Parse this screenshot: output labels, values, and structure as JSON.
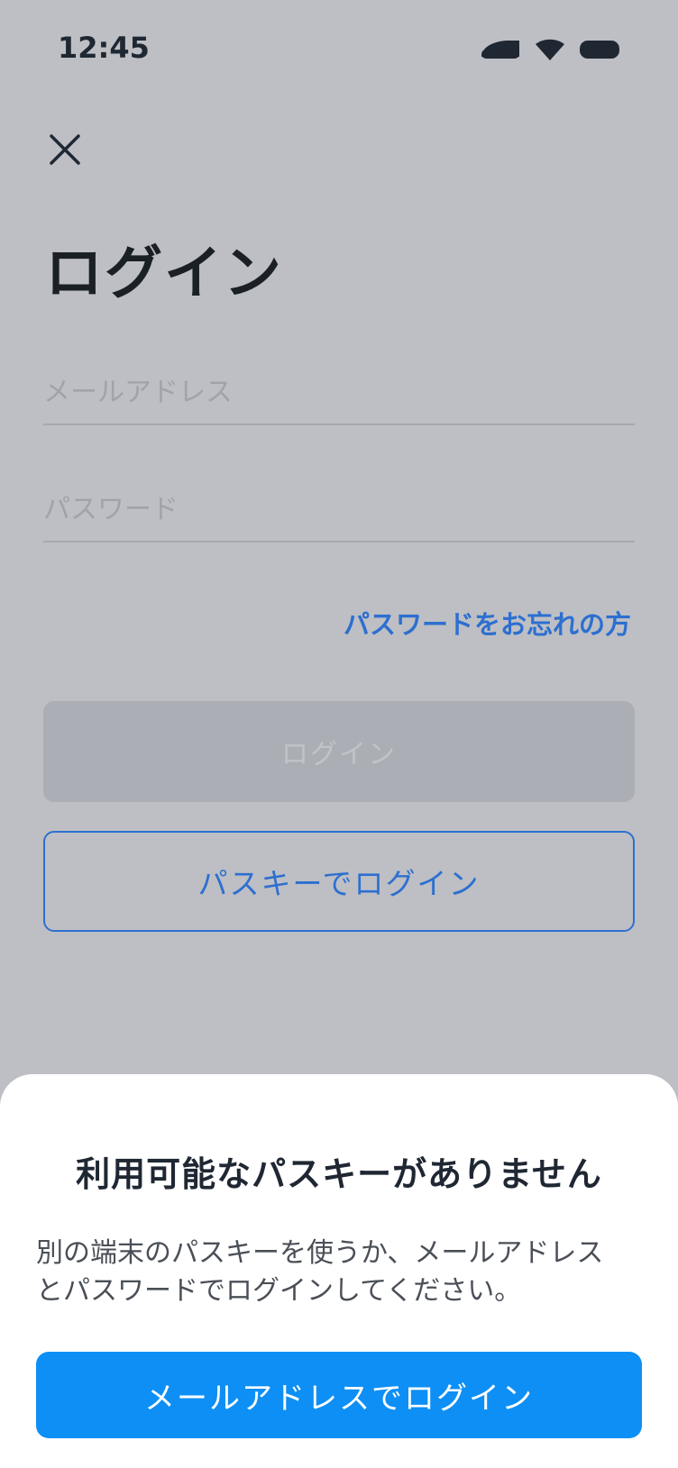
{
  "status_bar": {
    "time": "12:45",
    "icons": [
      "cellular-icon",
      "wifi-icon",
      "battery-icon"
    ]
  },
  "header": {
    "close_icon": "close-icon",
    "title": "ログイン"
  },
  "form": {
    "email": {
      "value": "",
      "placeholder": "メールアドレス"
    },
    "password": {
      "value": "",
      "placeholder": "パスワード"
    },
    "forgot_link": "パスワードをお忘れの方",
    "login_button": "ログイン",
    "passkey_button": "パスキーでログイン"
  },
  "sheet": {
    "title": "利用可能なパスキーがありません",
    "message_line1": "別の端末のパスキーを使うか、メールアドレス",
    "message_line2": "とパスワードでログインしてください。",
    "email_login_button": "メールアドレスでログイン"
  },
  "colors": {
    "background_dimmed": "#bdbfc4",
    "accent_link": "#2d6fd0",
    "primary_button": "#0d8ff5",
    "disabled_button": "#abaeb4"
  }
}
